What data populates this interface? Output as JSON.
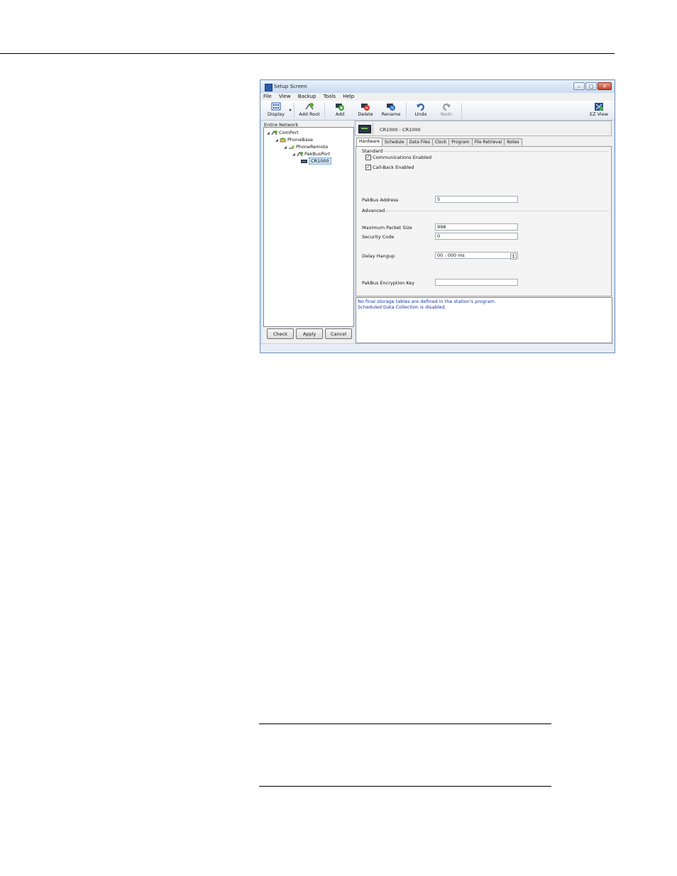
{
  "window": {
    "title": "Setup Screen",
    "controls": {
      "minimize": "–",
      "maximize": "□",
      "close": "✕"
    }
  },
  "menu": [
    "File",
    "View",
    "Backup",
    "Tools",
    "Help"
  ],
  "toolbar": {
    "display": "Display",
    "add_root": "Add Root",
    "add": "Add",
    "delete": "Delete",
    "rename": "Rename",
    "undo": "Undo",
    "redo": "Redo",
    "ez_view": "EZ View"
  },
  "network": {
    "caption": "Entire Network",
    "nodes": [
      "ComPort",
      "PhoneBase",
      "PhoneRemote",
      "PakBusPort",
      "CR1000"
    ]
  },
  "left_buttons": {
    "check": "Check",
    "apply": "Apply",
    "cancel": "Cancel"
  },
  "device_header": "CR1000 : CR1000",
  "tabs": [
    "Hardware",
    "Schedule",
    "Data Files",
    "Clock",
    "Program",
    "File Retrieval",
    "Notes"
  ],
  "hardware": {
    "standard_label": "Standard",
    "communications_enabled": "Communications Enabled",
    "callback_enabled": "Call-Back Enabled",
    "pakbus_address_label": "PakBus Address",
    "pakbus_address": "5",
    "advanced_label": "Advanced",
    "max_packet_size_label": "Maximum Packet Size",
    "max_packet_size": "998",
    "security_code_label": "Security Code",
    "security_code": "0",
    "delay_hangup_label": "Delay Hangup",
    "delay_hangup": "00 : 000 ms",
    "encryption_key_label": "PakBus Encryption Key",
    "encryption_key": ""
  },
  "messages": [
    "No final storage tables are defined in the station's program.",
    "Scheduled Data Collection is disabled."
  ]
}
